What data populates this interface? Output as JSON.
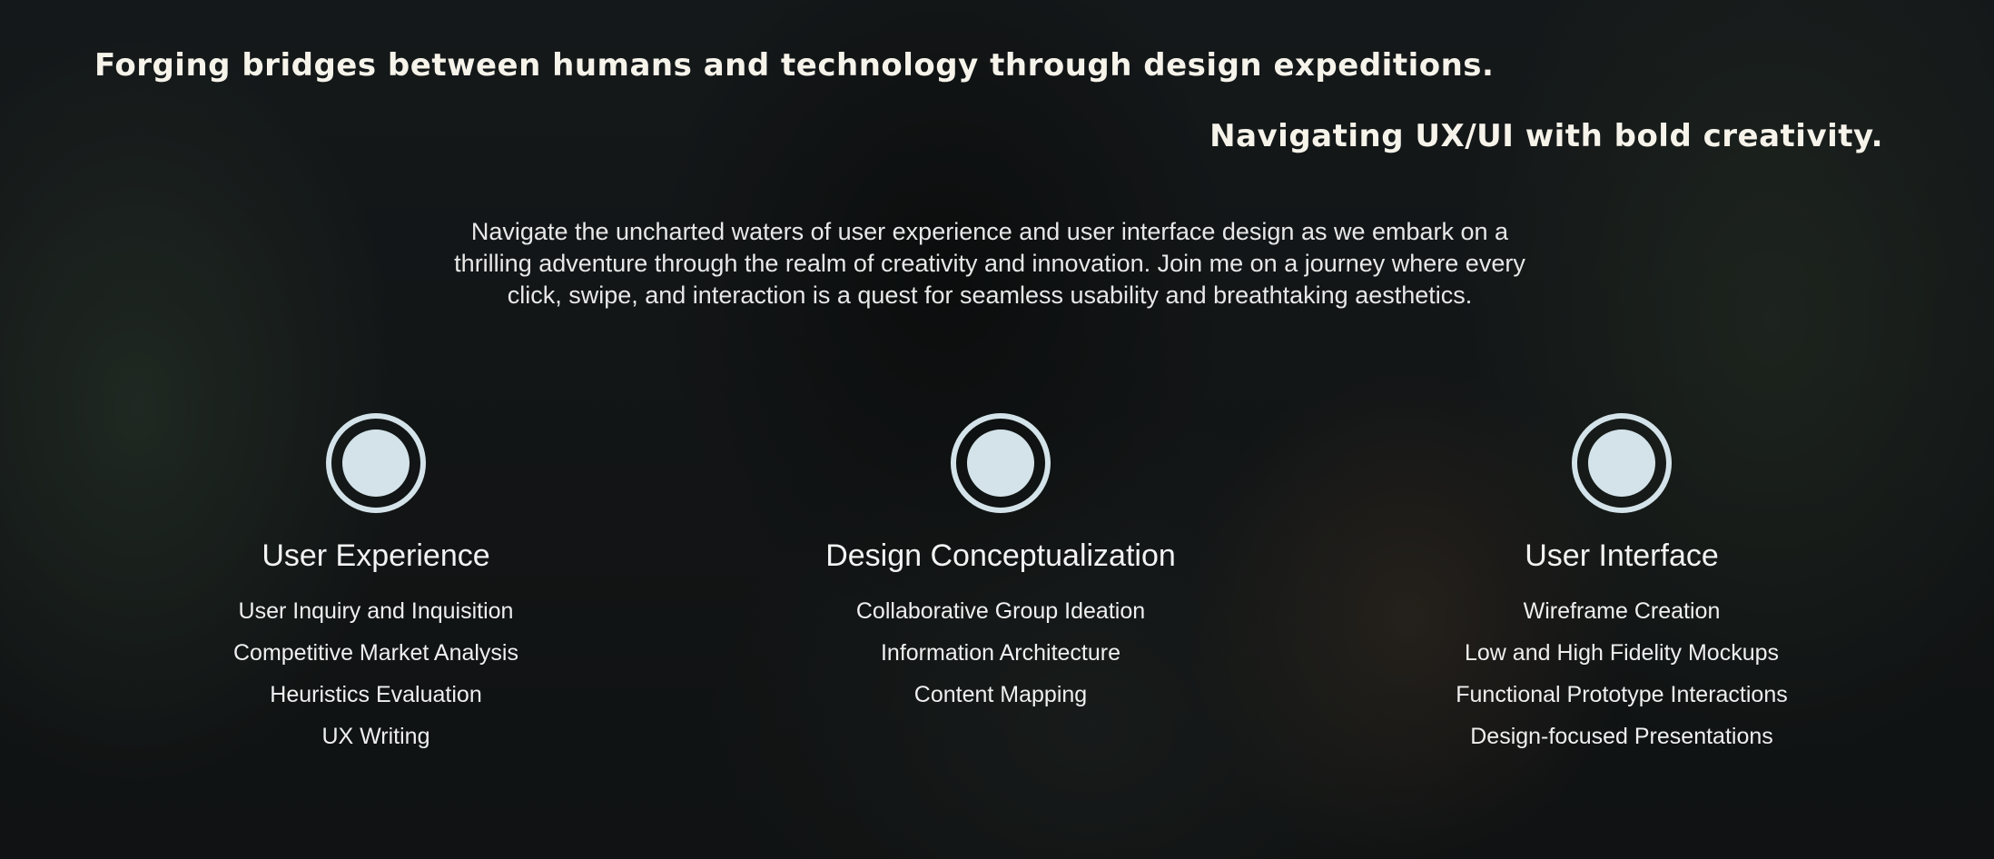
{
  "header": {
    "tagline_primary": "Forging bridges between humans and technology through design expeditions.",
    "tagline_secondary": "Navigating UX/UI with bold creativity."
  },
  "intro": {
    "text": "Navigate the uncharted waters of user experience and user interface design as we embark on a thrilling adventure through the realm of creativity and innovation. Join me on a journey where every click, swipe, and interaction is a quest for seamless usability and breathtaking aesthetics."
  },
  "services": [
    {
      "icon": "circle-target-icon",
      "title": "User Experience",
      "items": [
        "User Inquiry and Inquisition",
        "Competitive Market Analysis",
        "Heuristics Evaluation",
        "UX Writing"
      ]
    },
    {
      "icon": "circle-target-icon",
      "title": "Design Conceptualization",
      "items": [
        "Collaborative Group Ideation",
        "Information Architecture",
        "Content Mapping"
      ]
    },
    {
      "icon": "circle-target-icon",
      "title": "User Interface",
      "items": [
        "Wireframe Creation",
        "Low and High Fidelity Mockups",
        "Functional Prototype Interactions",
        "Design-focused Presentations"
      ]
    }
  ],
  "colors": {
    "background": "#141617",
    "icon": "#d3e3e9",
    "text": "#f2f2f2"
  }
}
